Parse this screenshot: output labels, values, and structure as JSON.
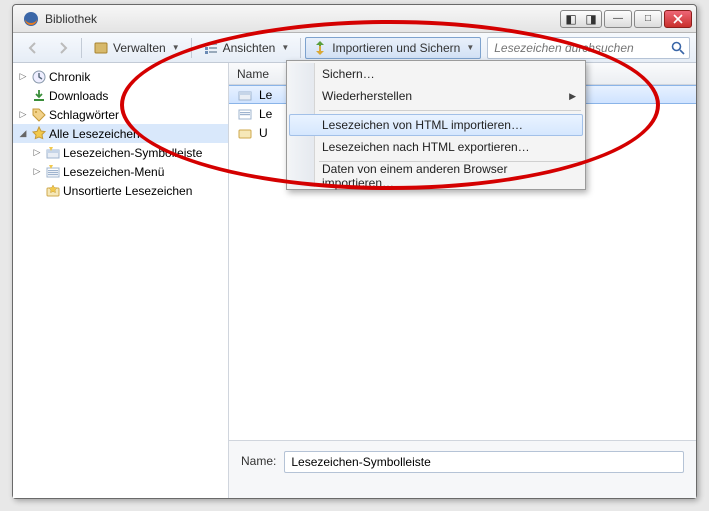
{
  "window": {
    "title": "Bibliothek"
  },
  "toolbar": {
    "back_tip": "Zurück",
    "forward_tip": "Vor",
    "organize_label": "Verwalten",
    "views_label": "Ansichten",
    "import_label": "Importieren und Sichern",
    "search_placeholder": "Lesezeichen durchsuchen"
  },
  "sidebar": {
    "items": [
      {
        "label": "Chronik",
        "icon": "clock"
      },
      {
        "label": "Downloads",
        "icon": "download"
      },
      {
        "label": "Schlagwörter",
        "icon": "tag"
      },
      {
        "label": "Alle Lesezeichen",
        "icon": "star",
        "expanded": true
      },
      {
        "label": "Lesezeichen-Symbolleiste",
        "icon": "folder-bar",
        "child": true
      },
      {
        "label": "Lesezeichen-Menü",
        "icon": "folder-menu",
        "child": true
      },
      {
        "label": "Unsortierte Lesezeichen",
        "icon": "folder-unsorted",
        "child": true
      }
    ]
  },
  "list": {
    "column_name": "Name",
    "rows": [
      {
        "label": "Le",
        "icon": "folder-bar",
        "selected": true
      },
      {
        "label": "Le",
        "icon": "folder-menu"
      },
      {
        "label": "U",
        "icon": "folder-unsorted"
      }
    ]
  },
  "menu": {
    "items": [
      {
        "label": "Sichern…"
      },
      {
        "label": "Wiederherstellen",
        "submenu": true
      },
      {
        "sep": true
      },
      {
        "label": "Lesezeichen von HTML importieren…",
        "hover": true
      },
      {
        "label": "Lesezeichen nach HTML exportieren…"
      },
      {
        "sep": true
      },
      {
        "label": "Daten von einem anderen Browser importieren…"
      }
    ]
  },
  "details": {
    "name_label": "Name:",
    "name_value": "Lesezeichen-Symbolleiste"
  }
}
